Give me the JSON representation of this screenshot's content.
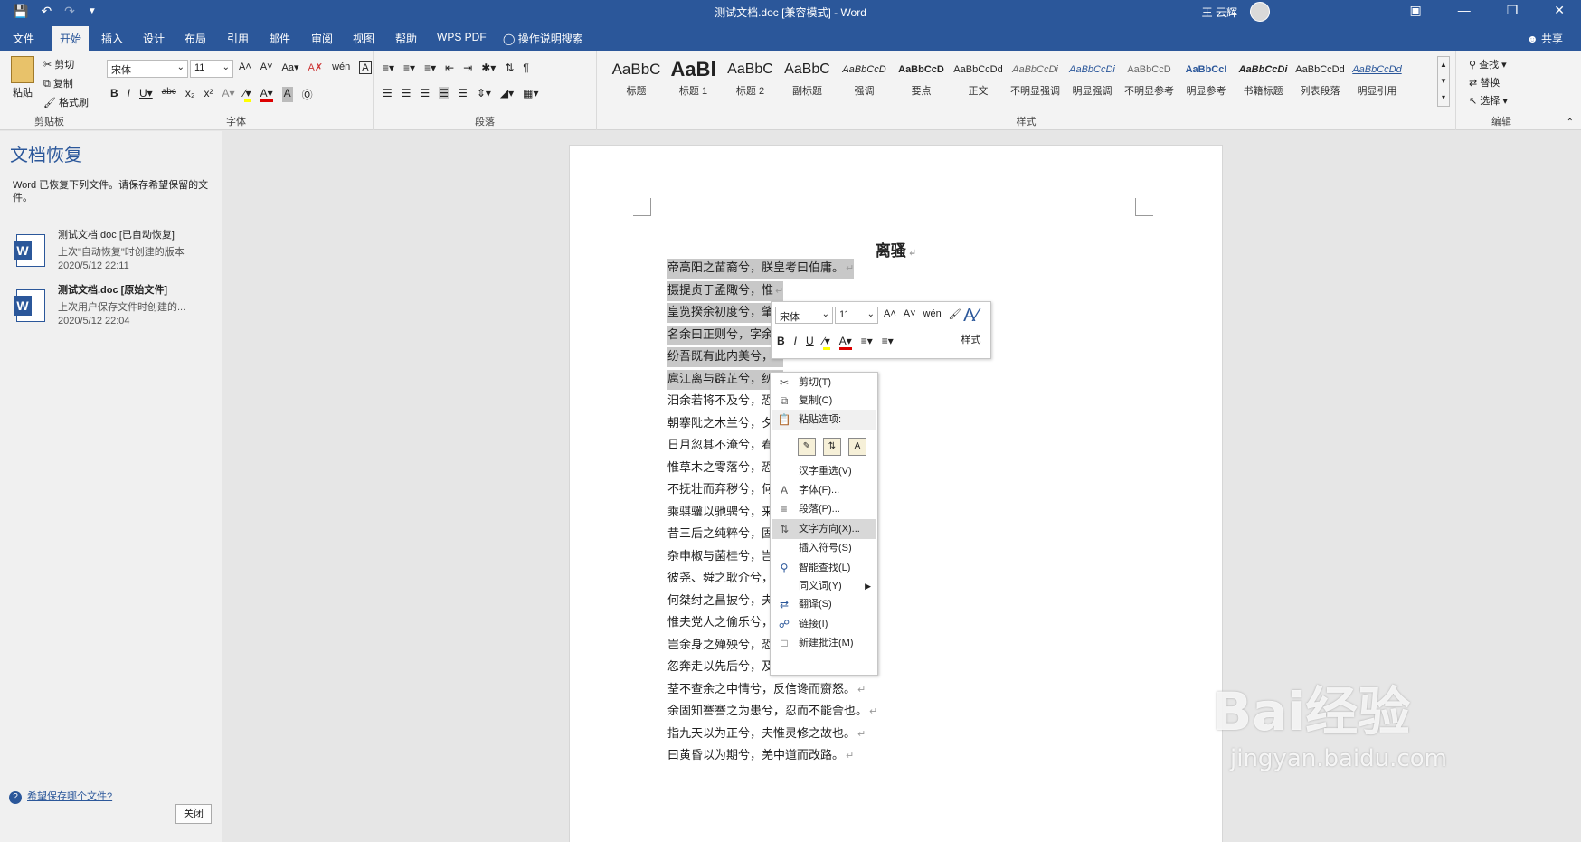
{
  "window": {
    "title": "测试文档.doc [兼容模式] - Word",
    "user": "王 云辉",
    "qat_icons": [
      "save-icon",
      "undo-icon",
      "redo-icon",
      "customize-icon"
    ]
  },
  "tabs": {
    "items": [
      "文件",
      "开始",
      "插入",
      "设计",
      "布局",
      "引用",
      "邮件",
      "审阅",
      "视图",
      "帮助",
      "WPS PDF"
    ],
    "active": "开始",
    "tell_me": "操作说明搜索",
    "share": "共享"
  },
  "ribbon": {
    "clipboard": {
      "paste": "粘贴",
      "cut": "剪切",
      "copy": "复制",
      "format_painter": "格式刷",
      "group": "剪贴板"
    },
    "font": {
      "name": "宋体",
      "size": "11",
      "group": "字体"
    },
    "paragraph": {
      "group": "段落"
    },
    "styles": {
      "group": "样式",
      "items": [
        {
          "sample": "AaBbC",
          "name": "标题"
        },
        {
          "sample": "AaBl",
          "name": "标题 1"
        },
        {
          "sample": "AaBbC",
          "name": "标题 2"
        },
        {
          "sample": "AaBbC",
          "name": "副标题"
        },
        {
          "sample": "AaBbCcD",
          "name": "强调"
        },
        {
          "sample": "AaBbCcD",
          "name": "要点"
        },
        {
          "sample": "AaBbCcDd",
          "name": "正文"
        },
        {
          "sample": "AaBbCcDi",
          "name": "不明显强调"
        },
        {
          "sample": "AaBbCcDi",
          "name": "明显强调"
        },
        {
          "sample": "AaBbCcD",
          "name": "不明显参考"
        },
        {
          "sample": "AaBbCcI",
          "name": "明显参考"
        },
        {
          "sample": "AaBbCcDi",
          "name": "书籍标题"
        },
        {
          "sample": "AaBbCcDd",
          "name": "列表段落"
        },
        {
          "sample": "AaBbCcDd",
          "name": "明显引用"
        }
      ]
    },
    "editing": {
      "find": "查找",
      "replace": "替换",
      "select": "选择",
      "group": "编辑"
    }
  },
  "recovery": {
    "title": "文档恢复",
    "description": "Word 已恢复下列文件。请保存希望保留的文件。",
    "files": [
      {
        "name": "测试文档.doc  [已自动恢复]",
        "sub": "上次\"自动恢复\"时创建的版本",
        "time": "2020/5/12 22:11"
      },
      {
        "name": "测试文档.doc  [原始文件]",
        "sub": "上次用户保存文件时创建的...",
        "time": "2020/5/12 22:04"
      }
    ],
    "help": "希望保存哪个文件?",
    "close": "关闭"
  },
  "document": {
    "title": "离骚",
    "lines": [
      "帝高阳之苗裔兮，朕皇考曰伯庸。",
      "摄提贞于孟陬兮，惟",
      "皇览揆余初度兮，肇",
      "名余曰正则兮，字余曰灵均。",
      "纷吾既有此内美兮，",
      "扈江离与辟芷兮，纫",
      "汩余若将不及兮，恐",
      "朝搴阰之木兰兮，夕",
      "日月忽其不淹兮，春",
      "惟草木之零落兮，恐",
      "不抚壮而弃秽兮，何",
      "乘骐骥以驰骋兮，来",
      "昔三后之纯粹兮，固",
      "杂申椒与菌桂兮，岂",
      "彼尧、舜之耿介兮，",
      "何桀纣之昌披兮，夫",
      "惟夫党人之偷乐兮，路幽昧以险隘。",
      "岂余身之殚殃兮，恐皇舆之败绩。",
      "忽奔走以先后兮，及前王之踵武。",
      "荃不查余之中情兮，反信谗而齌怒。",
      "余固知謇謇之为患兮，忍而不能舍也。",
      "指九天以为正兮，夫惟灵修之故也。",
      "曰黄昏以为期兮，羌中道而改路。"
    ],
    "selected_line_count": 6
  },
  "mini_toolbar": {
    "font": "宋体",
    "size": "11",
    "styles": "样式"
  },
  "context_menu": {
    "items": [
      {
        "label": "剪切(T)",
        "icon": "scissors-icon"
      },
      {
        "label": "复制(C)",
        "icon": "copy-icon"
      },
      {
        "label": "粘贴选项:",
        "icon": "paste-icon"
      },
      {
        "label": "汉字重选(V)",
        "icon": ""
      },
      {
        "label": "字体(F)...",
        "icon": "font-icon"
      },
      {
        "label": "段落(P)...",
        "icon": "paragraph-icon"
      },
      {
        "label": "文字方向(X)...",
        "icon": "text-direction-icon"
      },
      {
        "label": "插入符号(S)",
        "icon": ""
      },
      {
        "label": "智能查找(L)",
        "icon": "smart-lookup-icon"
      },
      {
        "label": "同义词(Y)",
        "icon": ""
      },
      {
        "label": "翻译(S)",
        "icon": "translate-icon"
      },
      {
        "label": "链接(I)",
        "icon": "link-icon"
      },
      {
        "label": "新建批注(M)",
        "icon": "comment-icon"
      }
    ],
    "highlighted": "文字方向(X)..."
  },
  "watermark": {
    "brand": "Bai经验",
    "url": "jingyan.baidu.com"
  },
  "colors": {
    "accent": "#2b579a",
    "selection": "#c8c8c8"
  }
}
